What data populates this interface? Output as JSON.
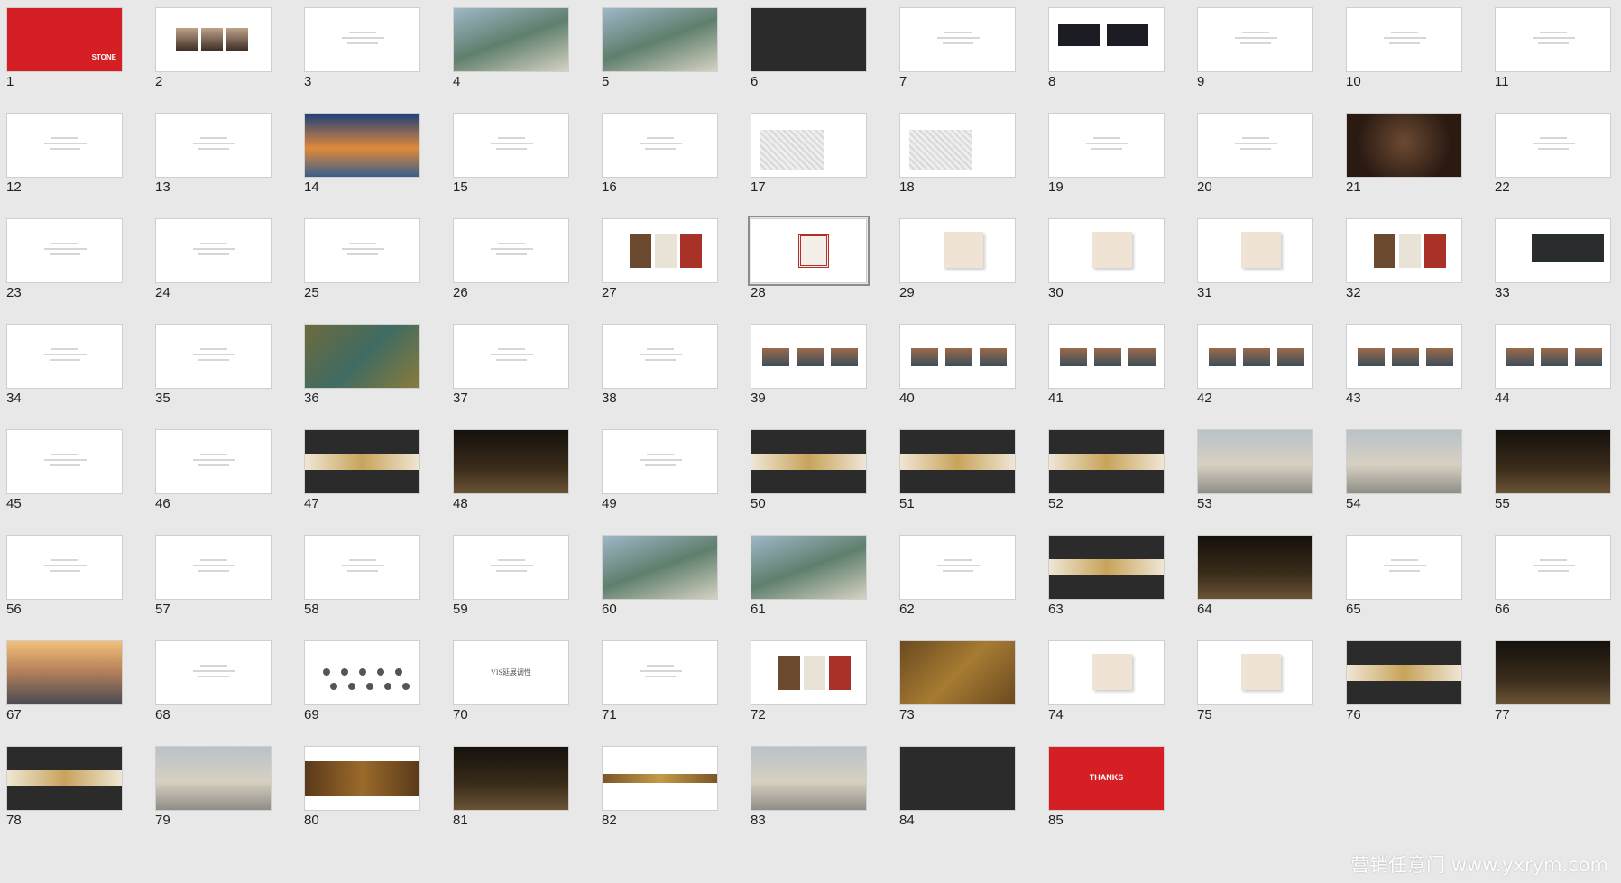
{
  "slides": [
    {
      "num": "1",
      "style": "red",
      "text": "STONE"
    },
    {
      "num": "2",
      "style": "white",
      "text": "",
      "kind": "people"
    },
    {
      "num": "3",
      "style": "white",
      "text": ""
    },
    {
      "num": "4",
      "style": "land",
      "text": ""
    },
    {
      "num": "5",
      "style": "land",
      "text": ""
    },
    {
      "num": "6",
      "style": "dark",
      "text": ""
    },
    {
      "num": "7",
      "style": "white",
      "text": ""
    },
    {
      "num": "8",
      "style": "white",
      "text": "",
      "kind": "dark-images"
    },
    {
      "num": "9",
      "style": "white",
      "text": ""
    },
    {
      "num": "10",
      "style": "white",
      "text": ""
    },
    {
      "num": "11",
      "style": "white",
      "text": ""
    },
    {
      "num": "12",
      "style": "white",
      "text": ""
    },
    {
      "num": "13",
      "style": "white",
      "text": ""
    },
    {
      "num": "14",
      "style": "sunset",
      "text": ""
    },
    {
      "num": "15",
      "style": "white",
      "text": ""
    },
    {
      "num": "16",
      "style": "white",
      "text": ""
    },
    {
      "num": "17",
      "style": "white",
      "text": "",
      "kind": "map"
    },
    {
      "num": "18",
      "style": "white",
      "text": "",
      "kind": "map"
    },
    {
      "num": "19",
      "style": "white",
      "text": ""
    },
    {
      "num": "20",
      "style": "white",
      "text": ""
    },
    {
      "num": "21",
      "style": "wood",
      "text": ""
    },
    {
      "num": "22",
      "style": "white",
      "text": ""
    },
    {
      "num": "23",
      "style": "white",
      "text": ""
    },
    {
      "num": "24",
      "style": "white",
      "text": ""
    },
    {
      "num": "25",
      "style": "white",
      "text": ""
    },
    {
      "num": "26",
      "style": "white",
      "text": ""
    },
    {
      "num": "27",
      "style": "white",
      "text": "",
      "kind": "cards"
    },
    {
      "num": "28",
      "style": "white",
      "text": "",
      "kind": "seal",
      "selected": true
    },
    {
      "num": "29",
      "style": "white",
      "text": "",
      "kind": "envelope"
    },
    {
      "num": "30",
      "style": "white",
      "text": "",
      "kind": "envelope"
    },
    {
      "num": "31",
      "style": "white",
      "text": "",
      "kind": "envelope"
    },
    {
      "num": "32",
      "style": "white",
      "text": "",
      "kind": "cards"
    },
    {
      "num": "33",
      "style": "white",
      "text": "",
      "kind": "darkbox"
    },
    {
      "num": "34",
      "style": "white",
      "text": ""
    },
    {
      "num": "35",
      "style": "white",
      "text": ""
    },
    {
      "num": "36",
      "style": "painting",
      "text": ""
    },
    {
      "num": "37",
      "style": "white",
      "text": ""
    },
    {
      "num": "38",
      "style": "white",
      "text": ""
    },
    {
      "num": "39",
      "style": "white",
      "text": "",
      "kind": "photos"
    },
    {
      "num": "40",
      "style": "white",
      "text": "",
      "kind": "photos"
    },
    {
      "num": "41",
      "style": "white",
      "text": "",
      "kind": "photos"
    },
    {
      "num": "42",
      "style": "white",
      "text": "",
      "kind": "photos"
    },
    {
      "num": "43",
      "style": "white",
      "text": "",
      "kind": "photos"
    },
    {
      "num": "44",
      "style": "white",
      "text": "",
      "kind": "photos"
    },
    {
      "num": "45",
      "style": "white",
      "text": ""
    },
    {
      "num": "46",
      "style": "white",
      "text": ""
    },
    {
      "num": "47",
      "style": "dark",
      "text": "",
      "kind": "banner"
    },
    {
      "num": "48",
      "style": "night",
      "text": ""
    },
    {
      "num": "49",
      "style": "white",
      "text": ""
    },
    {
      "num": "50",
      "style": "dark",
      "text": "",
      "kind": "banner"
    },
    {
      "num": "51",
      "style": "dark",
      "text": "",
      "kind": "banner"
    },
    {
      "num": "52",
      "style": "dark",
      "text": "",
      "kind": "banner"
    },
    {
      "num": "53",
      "style": "wall",
      "text": ""
    },
    {
      "num": "54",
      "style": "wall",
      "text": ""
    },
    {
      "num": "55",
      "style": "night",
      "text": ""
    },
    {
      "num": "56",
      "style": "white",
      "text": ""
    },
    {
      "num": "57",
      "style": "white",
      "text": ""
    },
    {
      "num": "58",
      "style": "white",
      "text": ""
    },
    {
      "num": "59",
      "style": "white",
      "text": ""
    },
    {
      "num": "60",
      "style": "land",
      "text": ""
    },
    {
      "num": "61",
      "style": "land",
      "text": ""
    },
    {
      "num": "62",
      "style": "white",
      "text": ""
    },
    {
      "num": "63",
      "style": "dark",
      "text": "",
      "kind": "banner"
    },
    {
      "num": "64",
      "style": "night",
      "text": ""
    },
    {
      "num": "65",
      "style": "white",
      "text": ""
    },
    {
      "num": "66",
      "style": "white",
      "text": ""
    },
    {
      "num": "67",
      "style": "city",
      "text": ""
    },
    {
      "num": "68",
      "style": "white",
      "text": ""
    },
    {
      "num": "69",
      "style": "white",
      "text": "",
      "kind": "dots"
    },
    {
      "num": "70",
      "style": "white",
      "text": "VIS延展调性"
    },
    {
      "num": "71",
      "style": "white",
      "text": ""
    },
    {
      "num": "72",
      "style": "white",
      "text": "",
      "kind": "cards"
    },
    {
      "num": "73",
      "style": "gold",
      "text": ""
    },
    {
      "num": "74",
      "style": "white",
      "text": "",
      "kind": "envelope"
    },
    {
      "num": "75",
      "style": "white",
      "text": "",
      "kind": "envelope"
    },
    {
      "num": "76",
      "style": "dark",
      "text": "",
      "kind": "banner"
    },
    {
      "num": "77",
      "style": "night",
      "text": ""
    },
    {
      "num": "78",
      "style": "dark",
      "text": "",
      "kind": "banner"
    },
    {
      "num": "79",
      "style": "wall",
      "text": ""
    },
    {
      "num": "80",
      "style": "white",
      "text": "",
      "kind": "goldband"
    },
    {
      "num": "81",
      "style": "night",
      "text": ""
    },
    {
      "num": "82",
      "style": "white",
      "text": "",
      "kind": "goldstrip"
    },
    {
      "num": "83",
      "style": "wall",
      "text": ""
    },
    {
      "num": "84",
      "style": "dark",
      "text": ""
    },
    {
      "num": "85",
      "style": "red",
      "text": "THANKS"
    }
  ],
  "watermark": "营销任意门 www.yxrym.com",
  "colors": {
    "background": "#e8e8e8",
    "red": "#d51f25",
    "dark": "#2b2b2b",
    "selected_border": "#8c8c8c"
  }
}
